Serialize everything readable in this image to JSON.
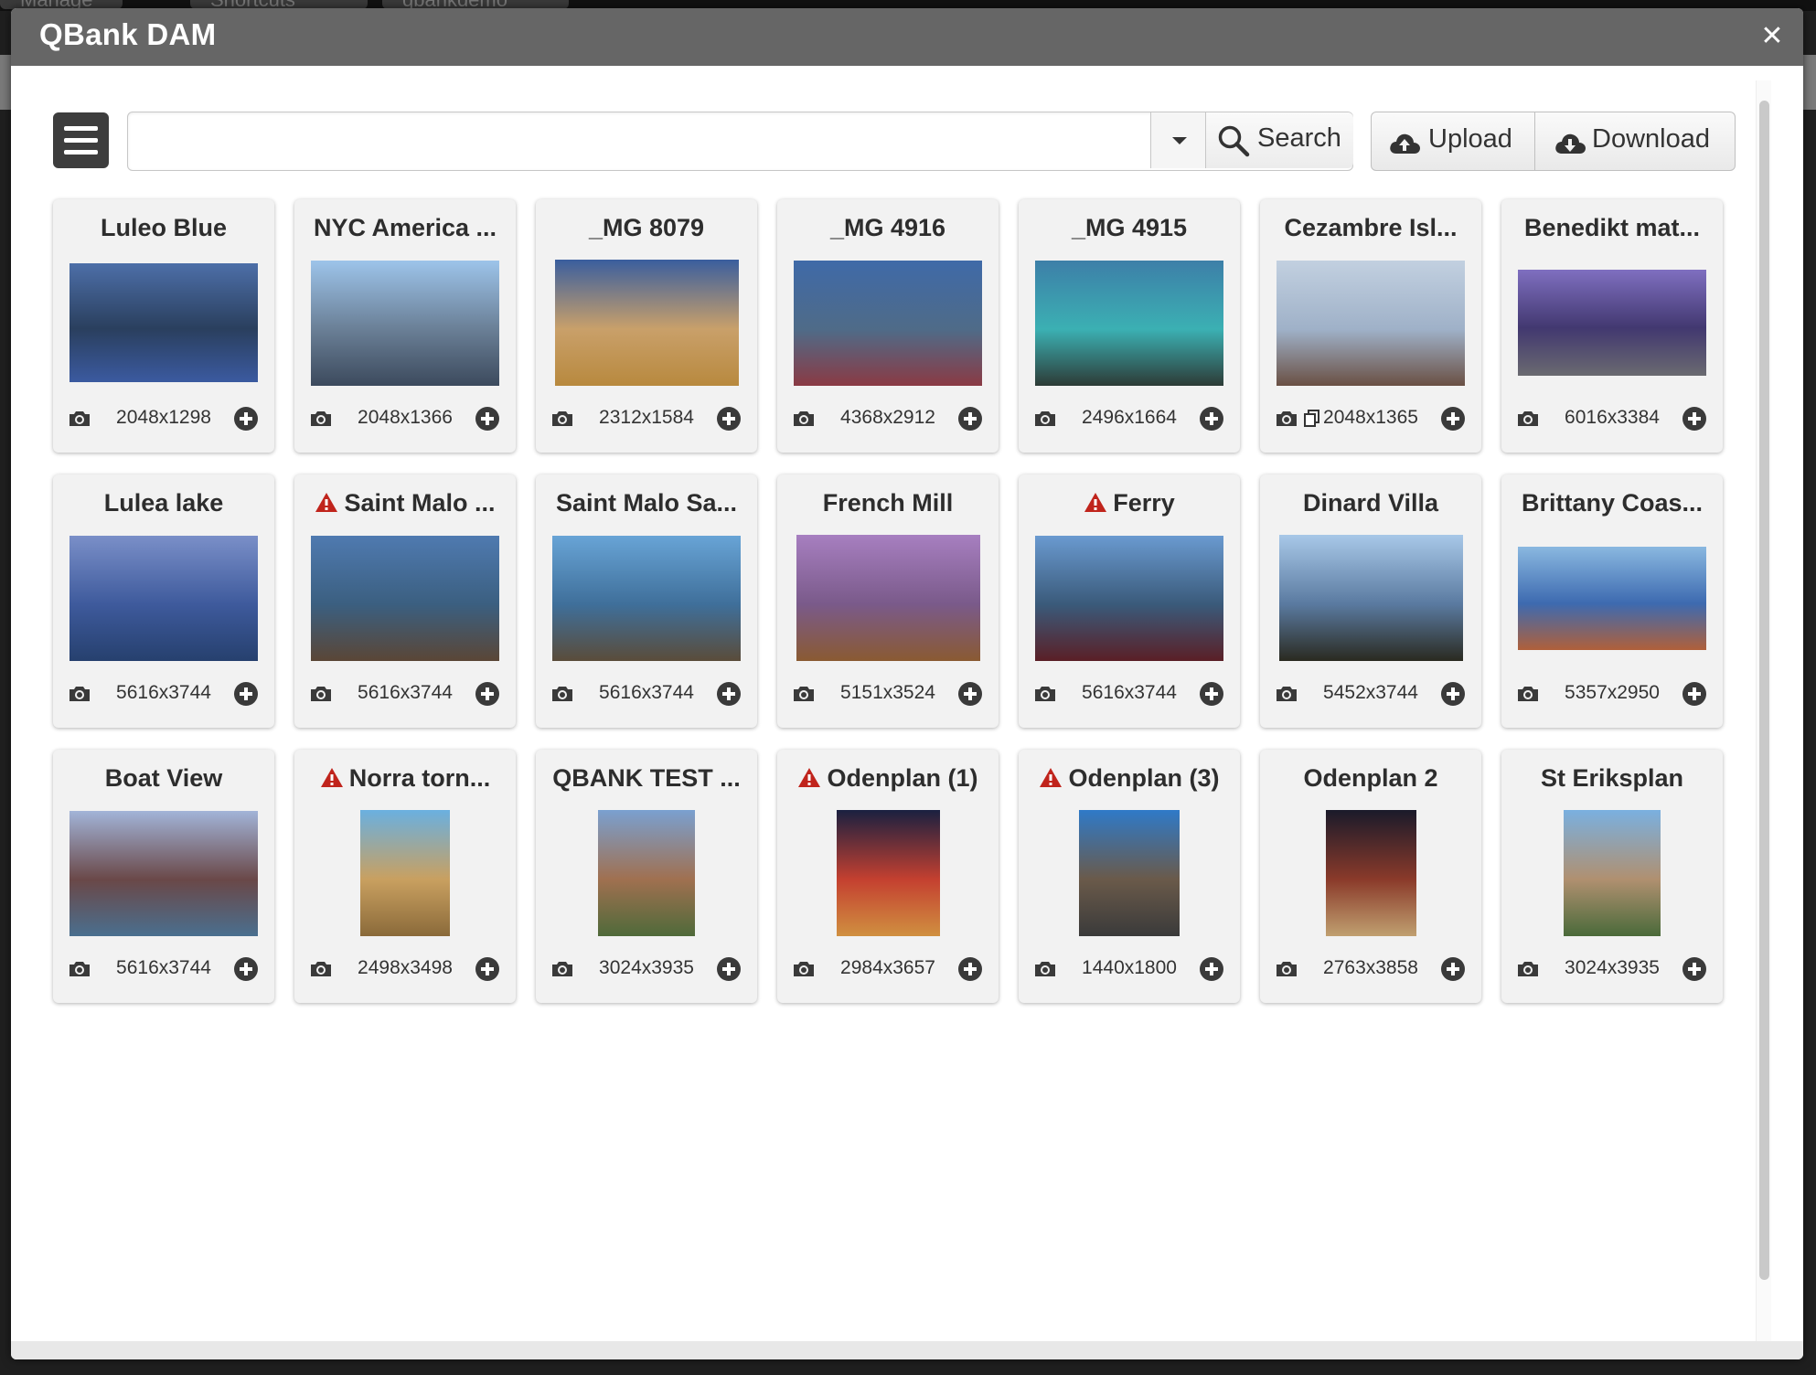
{
  "window": {
    "title": "QBank DAM"
  },
  "background_tabs": [
    "Manage",
    "Shortcuts",
    "qbankdemo"
  ],
  "toolbar": {
    "search_value": "",
    "search_label": "Search",
    "upload_label": "Upload",
    "download_label": "Download"
  },
  "icons": {
    "menu": "hamburger-icon",
    "search": "magnifier-icon",
    "upload": "cloud-upload-icon",
    "download": "cloud-download-icon",
    "close": "close-icon",
    "camera": "camera-icon",
    "add": "plus-circle-icon",
    "warning": "warning-triangle-icon"
  },
  "colors": {
    "titlebar": "#666666",
    "warning": "#c0241c",
    "menu_button": "#3d3d3d"
  },
  "cards": [
    {
      "title": "Luleo Blue",
      "dims": "2048x1298",
      "warning": false,
      "aspect": 1.58,
      "colors": [
        "#4d6fa8",
        "#2a3f5e",
        "#3b5aa0"
      ]
    },
    {
      "title": "NYC America ...",
      "dims": "2048x1366",
      "warning": false,
      "aspect": 1.5,
      "colors": [
        "#9dc4ea",
        "#6a7f96",
        "#3c4a5d"
      ]
    },
    {
      "title": "_MG 8079",
      "dims": "2312x1584",
      "warning": false,
      "aspect": 1.46,
      "colors": [
        "#3a5e9e",
        "#c9a06a",
        "#b8893e"
      ]
    },
    {
      "title": "_MG 4916",
      "dims": "4368x2912",
      "warning": false,
      "aspect": 1.5,
      "colors": [
        "#3f6aa8",
        "#4f6b88",
        "#8a3a44"
      ]
    },
    {
      "title": "_MG 4915",
      "dims": "2496x1664",
      "warning": false,
      "aspect": 1.5,
      "colors": [
        "#3d7fa8",
        "#3bb0b3",
        "#2d3b36"
      ]
    },
    {
      "title": "Cezambre Isl...",
      "dims": "2048x1365",
      "warning": false,
      "aspect": 1.5,
      "copy": true,
      "colors": [
        "#c2d0e0",
        "#9fb1c8",
        "#6a5044"
      ]
    },
    {
      "title": "Benedikt mat...",
      "dims": "6016x3384",
      "warning": false,
      "aspect": 1.78,
      "colors": [
        "#7f6fc0",
        "#423870",
        "#6a6a70"
      ]
    },
    {
      "title": "Lulea lake",
      "dims": "5616x3744",
      "warning": false,
      "aspect": 1.5,
      "colors": [
        "#7a8fc8",
        "#3e5a9c",
        "#26406e"
      ]
    },
    {
      "title": "Saint Malo ...",
      "dims": "5616x3744",
      "warning": true,
      "aspect": 1.5,
      "colors": [
        "#4f7ab0",
        "#3b5f80",
        "#5a4636"
      ]
    },
    {
      "title": "Saint Malo Sa...",
      "dims": "5616x3744",
      "warning": false,
      "aspect": 1.5,
      "colors": [
        "#68a4d6",
        "#3f6f9a",
        "#5a4c3a"
      ]
    },
    {
      "title": "French Mill",
      "dims": "5151x3524",
      "warning": false,
      "aspect": 1.46,
      "colors": [
        "#a77fc0",
        "#7a5a8a",
        "#8a5a32"
      ]
    },
    {
      "title": "Ferry",
      "dims": "5616x3744",
      "warning": true,
      "aspect": 1.5,
      "colors": [
        "#6a9ad0",
        "#3a5a7a",
        "#5a1f26"
      ]
    },
    {
      "title": "Dinard Villa",
      "dims": "5452x3744",
      "warning": false,
      "aspect": 1.46,
      "colors": [
        "#a8c8e8",
        "#5a7aa0",
        "#2a2a20"
      ]
    },
    {
      "title": "Brittany Coas...",
      "dims": "5357x2950",
      "warning": false,
      "aspect": 1.82,
      "colors": [
        "#8ab8e0",
        "#3d6ab0",
        "#b0603a"
      ]
    },
    {
      "title": "Boat View",
      "dims": "5616x3744",
      "warning": false,
      "aspect": 1.5,
      "colors": [
        "#a2b4d8",
        "#6a4848",
        "#4a6f8f"
      ]
    },
    {
      "title": "Norra torn...",
      "dims": "2498x3498",
      "warning": true,
      "aspect": 0.71,
      "colors": [
        "#6ab0e0",
        "#c9a060",
        "#8a6a3a"
      ]
    },
    {
      "title": "QBANK TEST ...",
      "dims": "3024x3935",
      "warning": false,
      "aspect": 0.77,
      "colors": [
        "#7aa0d0",
        "#a07050",
        "#4f6a3a"
      ]
    },
    {
      "title": "Odenplan (1)",
      "dims": "2984x3657",
      "warning": true,
      "aspect": 0.82,
      "colors": [
        "#1a2040",
        "#c44030",
        "#d09040"
      ]
    },
    {
      "title": "Odenplan (3)",
      "dims": "1440x1800",
      "warning": true,
      "aspect": 0.8,
      "colors": [
        "#2f7ac8",
        "#6a5a4a",
        "#3a3a3a"
      ]
    },
    {
      "title": "Odenplan 2",
      "dims": "2763x3858",
      "warning": false,
      "aspect": 0.72,
      "colors": [
        "#1a1a2a",
        "#8a3a2a",
        "#c0a070"
      ]
    },
    {
      "title": "St Eriksplan",
      "dims": "3024x3935",
      "warning": false,
      "aspect": 0.77,
      "colors": [
        "#7ab0e0",
        "#b09070",
        "#4a6a3a"
      ]
    }
  ]
}
